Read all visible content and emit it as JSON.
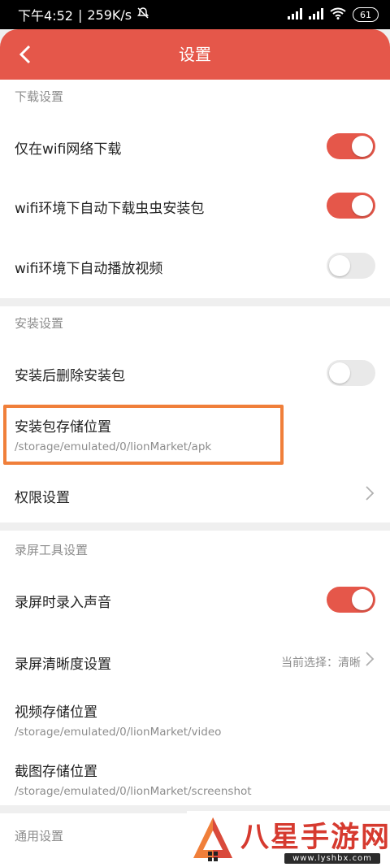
{
  "status_bar": {
    "time": "下午4:52",
    "net_speed": "259K/s",
    "battery": "61"
  },
  "header": {
    "title": "设置"
  },
  "sections": {
    "download": {
      "title": "下载设置",
      "wifi_only": {
        "label": "仅在wifi网络下载",
        "on": true
      },
      "auto_download": {
        "label": "wifi环境下自动下载虫虫安装包",
        "on": true
      },
      "auto_play": {
        "label": "wifi环境下自动播放视频",
        "on": false
      }
    },
    "install": {
      "title": "安装设置",
      "delete_after": {
        "label": "安装后删除安装包",
        "on": false
      },
      "storage": {
        "label": "安装包存储位置",
        "path": "/storage/emulated/0/lionMarket/apk"
      },
      "permissions": {
        "label": "权限设置"
      }
    },
    "recording": {
      "title": "录屏工具设置",
      "record_audio": {
        "label": "录屏时录入声音",
        "on": true
      },
      "clarity": {
        "label": "录屏清晰度设置",
        "current": "当前选择：清晰"
      },
      "video_storage": {
        "label": "视频存储位置",
        "path": "/storage/emulated/0/lionMarket/video"
      },
      "screenshot_storage": {
        "label": "截图存储位置",
        "path": "/storage/emulated/0/lionMarket/screenshot"
      }
    },
    "general": {
      "title": "通用设置"
    }
  },
  "watermark": {
    "text": "八星手游网",
    "url": "www.lyshbx.com"
  },
  "colors": {
    "accent": "#e5574a",
    "highlight": "#f07f3a",
    "toggle_off": "#e9e9e9"
  }
}
